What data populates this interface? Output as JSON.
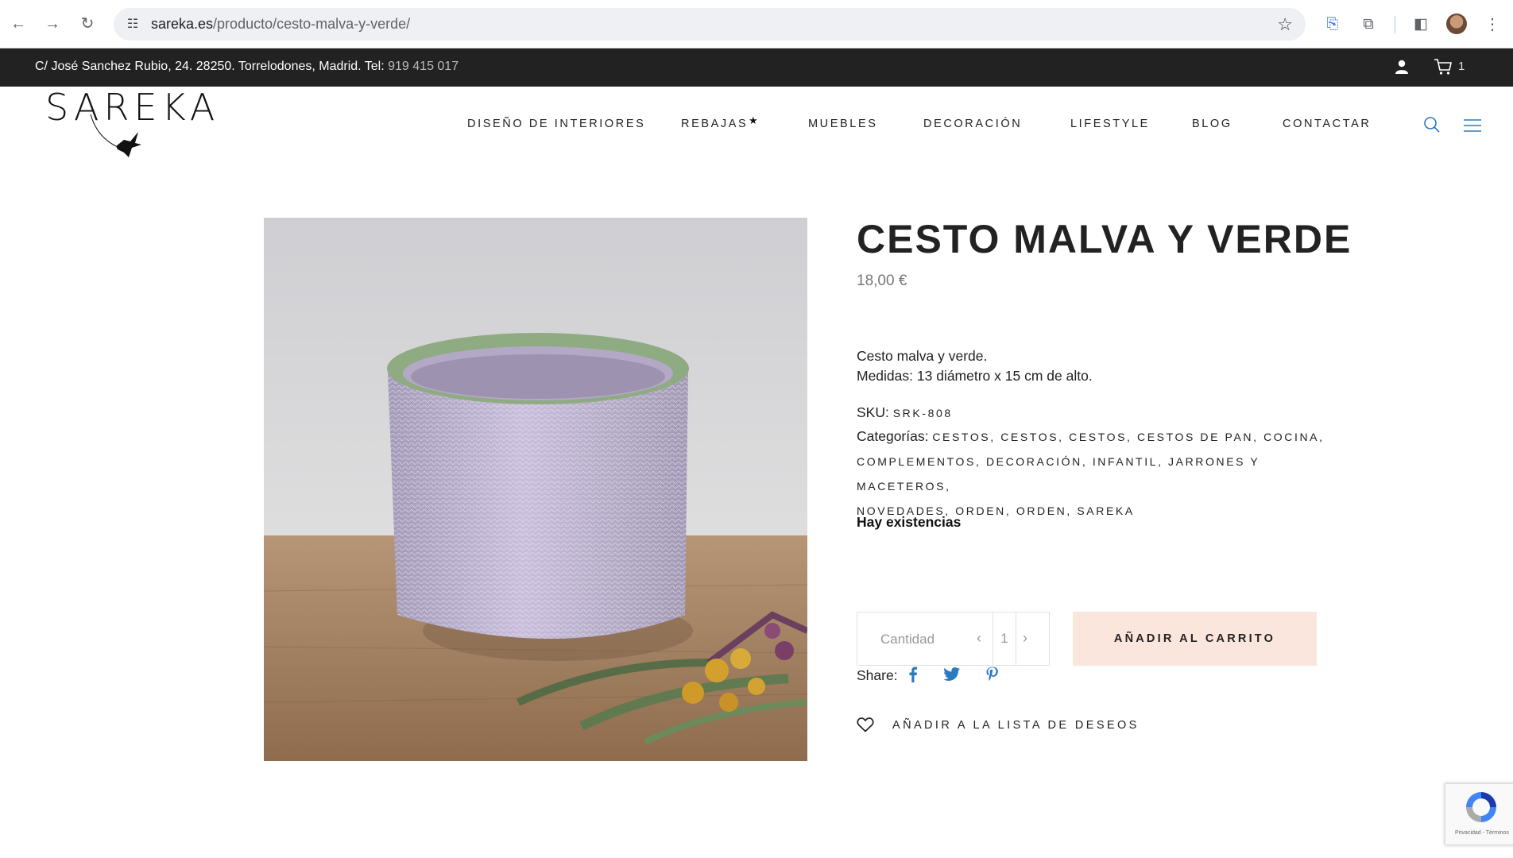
{
  "browser": {
    "url_host": "sareka.es",
    "url_path": "/producto/cesto-malva-y-verde/"
  },
  "topbar": {
    "address": "C/ José Sanchez Rubio, 24. 28250. Torrelodones, Madrid. Tel: ",
    "phone": "919 415 017",
    "cart_count": "1"
  },
  "header": {
    "logo_text": "SAREKA",
    "nav": [
      {
        "label": "DISEÑO DE INTERIORES"
      },
      {
        "label": "REBAJAS"
      },
      {
        "label": "MUEBLES"
      },
      {
        "label": "DECORACIÓN"
      },
      {
        "label": "LIFESTYLE"
      },
      {
        "label": "BLOG"
      },
      {
        "label": "CONTACTAR"
      }
    ],
    "rebajas_mark": "★"
  },
  "product": {
    "title": "CESTO MALVA Y VERDE",
    "price": "18,00 €",
    "desc_line1": "Cesto malva y verde.",
    "desc_line2": "Medidas: 13 diámetro x 15 cm de alto.",
    "sku_label": "SKU: ",
    "sku": "SRK-808",
    "categories_label": "Categorías: ",
    "categories_line1": "CESTOS, CESTOS, CESTOS, CESTOS DE PAN, COCINA,",
    "categories_line2": "COMPLEMENTOS, DECORACIÓN, INFANTIL, JARRONES Y MACETEROS,",
    "categories_line3": "NOVEDADES, ORDEN, ORDEN, SAREKA",
    "stock": "Hay existencias",
    "qty_placeholder": "Cantidad",
    "qty_value": "1",
    "qty_dec": "‹",
    "qty_inc": "›",
    "add_to_cart": "AÑADIR AL CARRITO",
    "share_label": "Share:",
    "wishlist": "AÑADIR A LA LISTA DE DESEOS"
  },
  "recaptcha": {
    "tos": "Privacidad - Términos"
  },
  "colors": {
    "topbar_bg": "#232222",
    "cart_button_bg": "#fbe6dd",
    "accent_icon": "#2a7ac1"
  }
}
